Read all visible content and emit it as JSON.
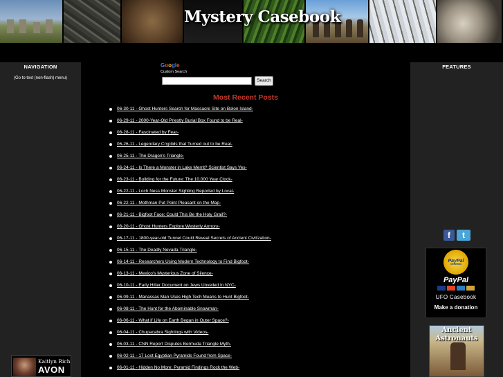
{
  "header": {
    "title": "Mystery Casebook"
  },
  "left_sidebar": {
    "heading": "NAVIGATION",
    "text_menu_link": "(Go to text (non-flash) menu)",
    "ad": {
      "name": "Kaitlyn Rich",
      "brand": "AVON"
    }
  },
  "right_sidebar": {
    "heading": "FEATURES",
    "social": {
      "facebook_glyph": "f",
      "twitter_glyph": "t"
    },
    "donate": {
      "badge_top": "PayPal",
      "badge_bottom": "VERIFIED",
      "brand": "PayPal",
      "org": "UFO Casebook",
      "cta": "Make a donation"
    },
    "book_ad": {
      "title_line1": "Ancient",
      "title_line2": "Astronauts"
    }
  },
  "search": {
    "logo_parts": [
      "G",
      "o",
      "o",
      "g",
      "l",
      "e"
    ],
    "subtitle": "Custom Search",
    "input_value": "",
    "button_label": "Search"
  },
  "main": {
    "section_title": "Most Recent Posts",
    "posts": [
      "06-30-11 - Ghost Hunters Search for Massacre Site on Bolon Island-",
      "06-29-11 - 2000-Year-Old Priestly Burial Box Found to be Real-",
      "06-28-11 - Fascinated by Fear-",
      "06-26-11 - Legendary Cryptids that Turned out to be Real-",
      "06-25-11 - The Dragon's Triangle-",
      "06-24-11 - Is There a Monster in Lake Merrit? Scientist Says Yes-",
      "06-23-11 - Building for the Future: The 10,000 Year Clock-",
      "06-22-11 - Loch Ness Monster Sighting Reported by Local-",
      "06-22-11 - Mothman Put Point Pleasant on the Map-",
      "06-21-11 - Bigfoot Face: Could This Be the Holy Grail?-",
      "06-20-11 - Ghost Hunters Explore Westerly Armory-",
      "06-17-11 - 1800-year-old Tunnel Could Reveal Secrets of Ancient Civilization-",
      "06-15-11 - The Deadly Nevada Triangle-",
      "06-14-11 - Researchers Using Modern Technology to Find Bigfoot-",
      "06-13-11 - Mexico's Mysterious Zone of Silence-",
      "06-10-11 - Early Hitler Document on Jews Unveiled in NYC-",
      "06-09-11 - Manassas Man Uses High Tech Means to Hunt Bigfoot-",
      "06-08-11 - The Hunt for the Abominable Snowman-",
      "06-06-11 - What if Life on Earth Began in Outer Space?-",
      "06-04-11 - Chupacabra Sightings with Videos-",
      "06-03-11 - CNN Report Disputes Bermuda Triangle Myth-",
      "06-02-11 - 17 Lost Egyptian Pyramids Found from Space-",
      "06-01-11 - Hidden No More: Pyramid Findings Rock the Web-"
    ]
  },
  "colors": {
    "page_bg": "#000000",
    "sidebar_bg": "#222222",
    "section_title": "#c0392b"
  }
}
